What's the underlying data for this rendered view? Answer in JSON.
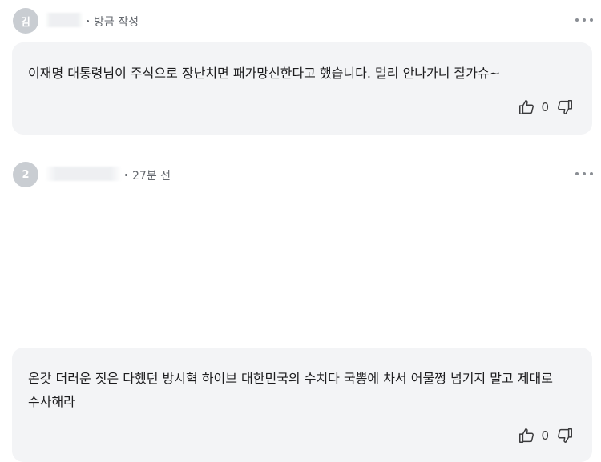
{
  "comments": [
    {
      "avatar_initial": "김",
      "timestamp": "방금 작성",
      "body": "이재명 대통령님이 주식으로 장난치면 패가망신한다고 했습니다. 멀리 안나가니 잘가슈~",
      "like_count": "0",
      "icons": {
        "like": "thumbs-up-icon",
        "dislike": "thumbs-down-icon",
        "more": "more-options-icon"
      }
    },
    {
      "avatar_initial": "2",
      "timestamp": "27분 전",
      "body": "온갖 더러운 짓은 다했던 방시혁 하이브 대한민국의 수치다 국뽕에 차서 어물쩡 넘기지 말고 제대로 수사해라",
      "like_count": "0",
      "icons": {
        "like": "thumbs-up-icon",
        "dislike": "thumbs-down-icon",
        "more": "more-options-icon"
      }
    }
  ],
  "colors": {
    "bubble_bg": "#f3f4f6",
    "avatar_bg": "#c9cdd2",
    "meta_text": "#666a70"
  }
}
